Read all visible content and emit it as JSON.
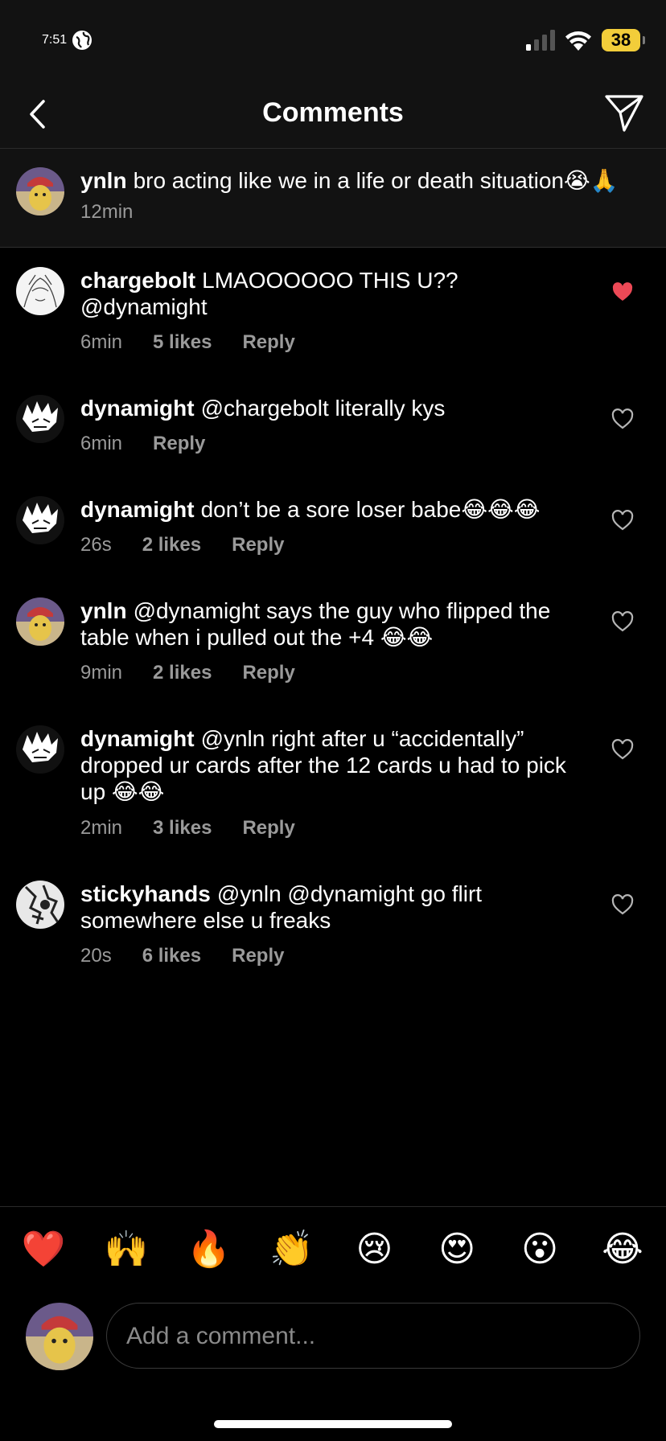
{
  "status": {
    "time": "7:51",
    "battery": "38"
  },
  "header": {
    "title": "Comments"
  },
  "caption": {
    "user": "ynln",
    "text": "bro acting like we in a life or death situation😭🙏",
    "time": "12min"
  },
  "comments": [
    {
      "user": "chargebolt",
      "text": "LMAOOOOOO THIS U?? @dynamight",
      "time": "6min",
      "likes": "5 likes",
      "reply": "Reply",
      "liked": true
    },
    {
      "user": "dynamight",
      "text": "@chargebolt literally kys",
      "time": "6min",
      "likes": "",
      "reply": "Reply",
      "liked": false
    },
    {
      "user": "dynamight",
      "text": "don’t be a sore loser babe😂😂😂",
      "time": "26s",
      "likes": "2 likes",
      "reply": "Reply",
      "liked": false
    },
    {
      "user": "ynln",
      "text": "@dynamight says the guy who flipped the table when i pulled out the +4 😂😂",
      "time": "9min",
      "likes": "2 likes",
      "reply": "Reply",
      "liked": false
    },
    {
      "user": "dynamight",
      "text": "@ynln right after u “accidentally” dropped ur cards after the 12 cards u had to pick up 😂😂",
      "time": "2min",
      "likes": "3 likes",
      "reply": "Reply",
      "liked": false
    },
    {
      "user": "stickyhands",
      "text": "@ynln @dynamight go flirt somewhere else u freaks",
      "time": "20s",
      "likes": "6 likes",
      "reply": "Reply",
      "liked": false
    }
  ],
  "reactions": [
    "❤️",
    "🙌",
    "🔥",
    "👏",
    "😢",
    "😍",
    "😮",
    "😂"
  ],
  "composer": {
    "placeholder": "Add a comment..."
  },
  "colors": {
    "liked_heart": "#ed4956",
    "meta_gray": "#9a9a9a",
    "battery": "#f2cd3a"
  }
}
